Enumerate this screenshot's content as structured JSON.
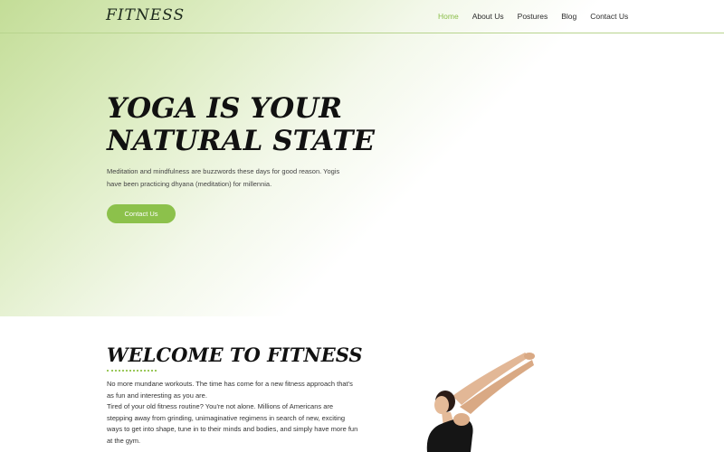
{
  "header": {
    "logo": "FITNESS",
    "nav": [
      {
        "label": "Home",
        "active": true
      },
      {
        "label": "About Us",
        "active": false
      },
      {
        "label": "Postures",
        "active": false
      },
      {
        "label": "Blog",
        "active": false
      },
      {
        "label": "Contact Us",
        "active": false
      }
    ]
  },
  "hero": {
    "title_line1": "YOGA IS YOUR",
    "title_line2": "NATURAL STATE",
    "description": "Meditation and mindfulness are buzzwords these days for good reason. Yogis have been practicing dhyana (meditation) for millennia.",
    "cta_label": "Contact Us"
  },
  "welcome": {
    "title": "WELCOME TO FITNESS",
    "paragraph1": "No more mundane workouts. The time has come for a new fitness approach that's as fun and interesting as you are.",
    "paragraph2": "Tired of your old fitness routine? You're not alone. Millions of Americans are stepping away from grinding, unimaginative regimens in search of new, exciting ways to get into shape, tune in to their minds and bodies, and simply have more fun at the gym."
  },
  "colors": {
    "accent": "#8cc14b",
    "active_nav": "#8bbe49",
    "hero_gradient": "#c3dd97"
  }
}
